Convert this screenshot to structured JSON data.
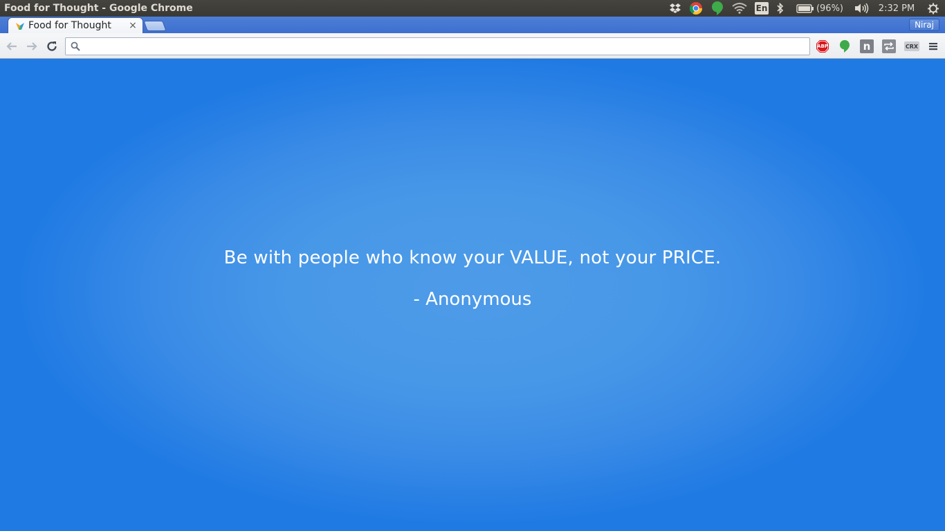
{
  "system_panel": {
    "window_title": "Food for Thought - Google Chrome",
    "keyboard_layout": "En",
    "battery_text": "(96%)",
    "clock": "2:32 PM",
    "icons": [
      "dropbox-icon",
      "chrome-icon",
      "hangouts-icon",
      "wifi-icon",
      "keyboard-layout-icon",
      "bluetooth-icon",
      "battery-icon",
      "volume-icon",
      "session-gear-icon"
    ]
  },
  "browser": {
    "tabs": [
      {
        "label": "Food for Thought",
        "active": true,
        "close_glyph": "×"
      }
    ],
    "profile_name": "Niraj",
    "omnibox": {
      "value": "",
      "placeholder": ""
    },
    "extensions": [
      {
        "name": "adblock-plus-icon",
        "text": "ABP"
      },
      {
        "name": "hangouts-extension-icon",
        "text": ""
      },
      {
        "name": "n-extension-icon",
        "text": "n"
      },
      {
        "name": "repeat-extension-icon",
        "text": ""
      },
      {
        "name": "crx-extension-icon",
        "text": "CRX"
      }
    ]
  },
  "content": {
    "quote": "Be with people who know your VALUE, not your PRICE.",
    "author": "- Anonymous",
    "colors": {
      "background_edge": "#1f7ae3",
      "background_center": "#4d9be8",
      "text": "#ffffff"
    }
  }
}
